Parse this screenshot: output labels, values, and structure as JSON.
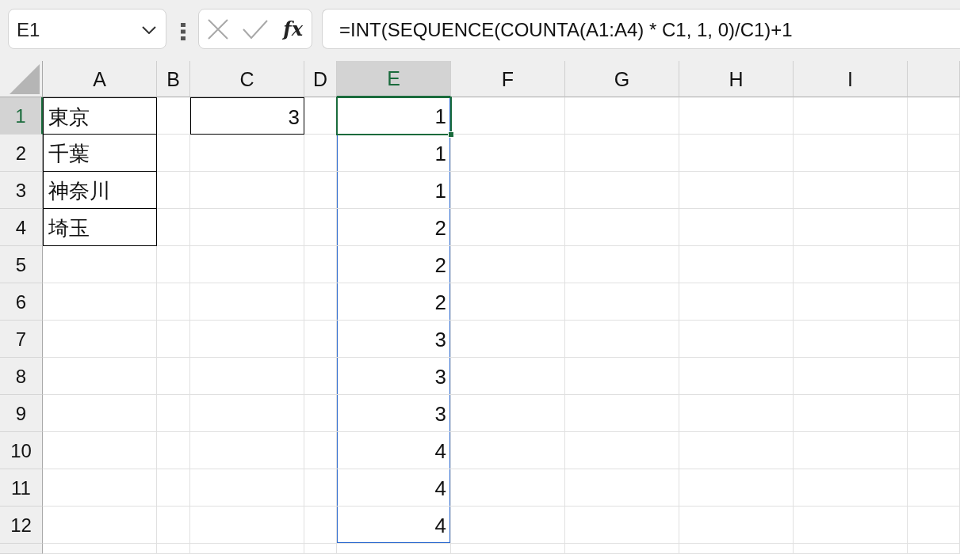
{
  "name_box": {
    "value": "E1"
  },
  "formula_bar": {
    "insert_function_label": "fx",
    "formula": "=INT(SEQUENCE(COUNTA(A1:A4) * C1, 1, 0)/C1)+1"
  },
  "columns": [
    {
      "label": "A",
      "selected": false
    },
    {
      "label": "B",
      "selected": false
    },
    {
      "label": "C",
      "selected": false
    },
    {
      "label": "D",
      "selected": false
    },
    {
      "label": "E",
      "selected": true
    },
    {
      "label": "F",
      "selected": false
    },
    {
      "label": "G",
      "selected": false
    },
    {
      "label": "H",
      "selected": false
    },
    {
      "label": "I",
      "selected": false
    }
  ],
  "rows": [
    {
      "label": "1",
      "selected": true,
      "cells": [
        {
          "kind": "text",
          "value": "東京",
          "bordered": true,
          "active": false,
          "spill": false
        },
        {
          "kind": "empty"
        },
        {
          "kind": "number",
          "value": "3",
          "bordered": true,
          "active": false,
          "spill": false
        },
        {
          "kind": "empty"
        },
        {
          "kind": "number",
          "value": "1",
          "bordered": false,
          "active": true,
          "spill": true
        },
        {
          "kind": "empty"
        },
        {
          "kind": "empty"
        },
        {
          "kind": "empty"
        },
        {
          "kind": "empty"
        }
      ]
    },
    {
      "label": "2",
      "selected": false,
      "cells": [
        {
          "kind": "text",
          "value": "千葉",
          "bordered": true,
          "active": false,
          "spill": false
        },
        {
          "kind": "empty"
        },
        {
          "kind": "empty"
        },
        {
          "kind": "empty"
        },
        {
          "kind": "number",
          "value": "1",
          "bordered": false,
          "active": false,
          "spill": true
        },
        {
          "kind": "empty"
        },
        {
          "kind": "empty"
        },
        {
          "kind": "empty"
        },
        {
          "kind": "empty"
        }
      ]
    },
    {
      "label": "3",
      "selected": false,
      "cells": [
        {
          "kind": "text",
          "value": "神奈川",
          "bordered": true,
          "active": false,
          "spill": false
        },
        {
          "kind": "empty"
        },
        {
          "kind": "empty"
        },
        {
          "kind": "empty"
        },
        {
          "kind": "number",
          "value": "1",
          "bordered": false,
          "active": false,
          "spill": true
        },
        {
          "kind": "empty"
        },
        {
          "kind": "empty"
        },
        {
          "kind": "empty"
        },
        {
          "kind": "empty"
        }
      ]
    },
    {
      "label": "4",
      "selected": false,
      "cells": [
        {
          "kind": "text",
          "value": "埼玉",
          "bordered": true,
          "active": false,
          "spill": false
        },
        {
          "kind": "empty"
        },
        {
          "kind": "empty"
        },
        {
          "kind": "empty"
        },
        {
          "kind": "number",
          "value": "2",
          "bordered": false,
          "active": false,
          "spill": true
        },
        {
          "kind": "empty"
        },
        {
          "kind": "empty"
        },
        {
          "kind": "empty"
        },
        {
          "kind": "empty"
        }
      ]
    },
    {
      "label": "5",
      "selected": false,
      "cells": [
        {
          "kind": "empty"
        },
        {
          "kind": "empty"
        },
        {
          "kind": "empty"
        },
        {
          "kind": "empty"
        },
        {
          "kind": "number",
          "value": "2",
          "bordered": false,
          "active": false,
          "spill": true
        },
        {
          "kind": "empty"
        },
        {
          "kind": "empty"
        },
        {
          "kind": "empty"
        },
        {
          "kind": "empty"
        }
      ]
    },
    {
      "label": "6",
      "selected": false,
      "cells": [
        {
          "kind": "empty"
        },
        {
          "kind": "empty"
        },
        {
          "kind": "empty"
        },
        {
          "kind": "empty"
        },
        {
          "kind": "number",
          "value": "2",
          "bordered": false,
          "active": false,
          "spill": true
        },
        {
          "kind": "empty"
        },
        {
          "kind": "empty"
        },
        {
          "kind": "empty"
        },
        {
          "kind": "empty"
        }
      ]
    },
    {
      "label": "7",
      "selected": false,
      "cells": [
        {
          "kind": "empty"
        },
        {
          "kind": "empty"
        },
        {
          "kind": "empty"
        },
        {
          "kind": "empty"
        },
        {
          "kind": "number",
          "value": "3",
          "bordered": false,
          "active": false,
          "spill": true
        },
        {
          "kind": "empty"
        },
        {
          "kind": "empty"
        },
        {
          "kind": "empty"
        },
        {
          "kind": "empty"
        }
      ]
    },
    {
      "label": "8",
      "selected": false,
      "cells": [
        {
          "kind": "empty"
        },
        {
          "kind": "empty"
        },
        {
          "kind": "empty"
        },
        {
          "kind": "empty"
        },
        {
          "kind": "number",
          "value": "3",
          "bordered": false,
          "active": false,
          "spill": true
        },
        {
          "kind": "empty"
        },
        {
          "kind": "empty"
        },
        {
          "kind": "empty"
        },
        {
          "kind": "empty"
        }
      ]
    },
    {
      "label": "9",
      "selected": false,
      "cells": [
        {
          "kind": "empty"
        },
        {
          "kind": "empty"
        },
        {
          "kind": "empty"
        },
        {
          "kind": "empty"
        },
        {
          "kind": "number",
          "value": "3",
          "bordered": false,
          "active": false,
          "spill": true
        },
        {
          "kind": "empty"
        },
        {
          "kind": "empty"
        },
        {
          "kind": "empty"
        },
        {
          "kind": "empty"
        }
      ]
    },
    {
      "label": "10",
      "selected": false,
      "cells": [
        {
          "kind": "empty"
        },
        {
          "kind": "empty"
        },
        {
          "kind": "empty"
        },
        {
          "kind": "empty"
        },
        {
          "kind": "number",
          "value": "4",
          "bordered": false,
          "active": false,
          "spill": true
        },
        {
          "kind": "empty"
        },
        {
          "kind": "empty"
        },
        {
          "kind": "empty"
        },
        {
          "kind": "empty"
        }
      ]
    },
    {
      "label": "11",
      "selected": false,
      "cells": [
        {
          "kind": "empty"
        },
        {
          "kind": "empty"
        },
        {
          "kind": "empty"
        },
        {
          "kind": "empty"
        },
        {
          "kind": "number",
          "value": "4",
          "bordered": false,
          "active": false,
          "spill": true
        },
        {
          "kind": "empty"
        },
        {
          "kind": "empty"
        },
        {
          "kind": "empty"
        },
        {
          "kind": "empty"
        }
      ]
    },
    {
      "label": "12",
      "selected": false,
      "cells": [
        {
          "kind": "empty"
        },
        {
          "kind": "empty"
        },
        {
          "kind": "empty"
        },
        {
          "kind": "empty"
        },
        {
          "kind": "number",
          "value": "4",
          "bordered": false,
          "active": false,
          "spill": true
        },
        {
          "kind": "empty"
        },
        {
          "kind": "empty"
        },
        {
          "kind": "empty"
        },
        {
          "kind": "empty"
        }
      ]
    }
  ]
}
